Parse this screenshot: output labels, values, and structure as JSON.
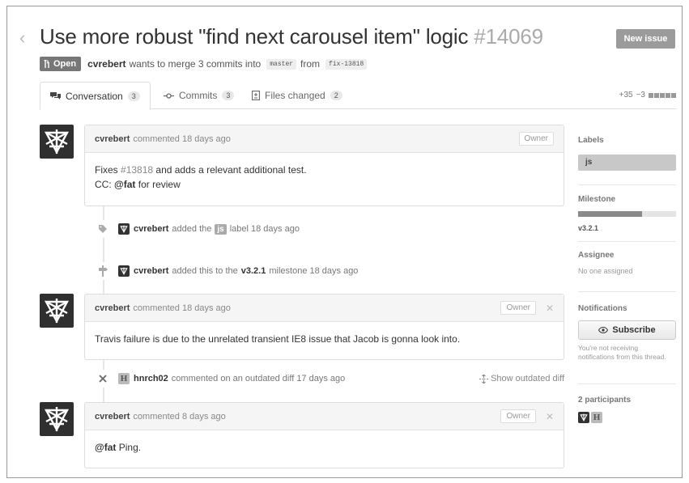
{
  "header": {
    "back_glyph": "‹",
    "title": "Use more robust \"find next carousel item\" logic",
    "number": "#14069",
    "new_issue_label": "New issue"
  },
  "state": {
    "badge": "Open",
    "author": "cvrebert",
    "merge_text": "wants to merge 3 commits into",
    "base_branch": "master",
    "from_text": "from",
    "head_branch": "fix-13818"
  },
  "tabs": [
    {
      "label": "Conversation",
      "count": "3",
      "icon": "comment-discussion-icon",
      "active": true
    },
    {
      "label": "Commits",
      "count": "3",
      "icon": "git-commit-icon",
      "active": false
    },
    {
      "label": "Files changed",
      "count": "2",
      "icon": "file-diff-icon",
      "active": false
    }
  ],
  "diffstat": {
    "additions": "+35",
    "deletions": "−3"
  },
  "timeline": {
    "comment1": {
      "author": "cvrebert",
      "meta": "commented 18 days ago",
      "badge": "Owner",
      "line1_pre": "Fixes",
      "line1_link": "#13818",
      "line1_post": "and adds a relevant additional test.",
      "line2_pre": "CC:",
      "line2_mention": "@fat",
      "line2_post": "for review"
    },
    "event_label": {
      "author": "cvrebert",
      "pre": "added the",
      "label": "js",
      "post": "label 18 days ago",
      "icon": "tag-icon"
    },
    "event_milestone": {
      "author": "cvrebert",
      "pre": "added this to the",
      "milestone": "v3.2.1",
      "post": "milestone 18 days ago",
      "icon": "milestone-icon"
    },
    "comment2": {
      "author": "cvrebert",
      "meta": "commented 18 days ago",
      "badge": "Owner",
      "close_glyph": "✕",
      "body": "Travis failure is due to the unrelated transient IE8 issue that Jacob is gonna look into."
    },
    "event_outdated": {
      "author": "hnrch02",
      "avatar_letter": "H",
      "text": "commented on an outdated diff 17 days ago",
      "action": "Show outdated diff",
      "icon": "x-icon"
    },
    "comment3": {
      "author": "cvrebert",
      "meta": "commented 8 days ago",
      "badge": "Owner",
      "close_glyph": "✕",
      "mention": "@fat",
      "body": "Ping."
    }
  },
  "sidebar": {
    "labels_heading": "Labels",
    "label": "js",
    "milestone_heading": "Milestone",
    "milestone": "v3.2.1",
    "milestone_progress": 0.65,
    "assignee_heading": "Assignee",
    "assignee": "No one assigned",
    "notifications_heading": "Notifications",
    "subscribe_label": "Subscribe",
    "notifications_note": "You're not receiving notifications from this thread.",
    "participants_heading": "2 participants",
    "participant_h": "H"
  },
  "colors": {
    "badge_gray": "#777777",
    "button_gray": "#9b9b9b",
    "avatar_dark": "#2f2f2f"
  }
}
